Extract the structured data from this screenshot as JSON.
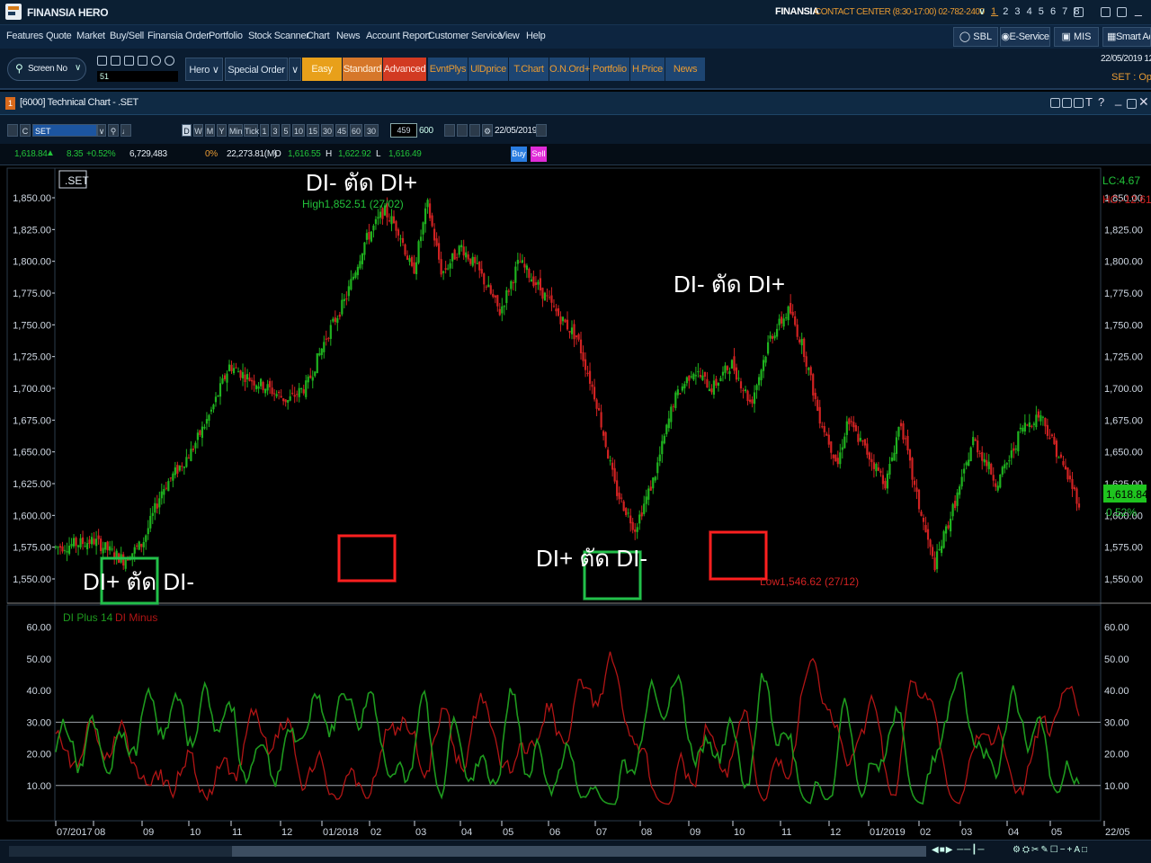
{
  "app": {
    "brand": "FINANSIA HERO",
    "brand_right": "FINANSIA",
    "contact": "CONTACT CENTER (8:30-17:00) 02-782-2400",
    "page_numbers": [
      "1",
      "2",
      "3",
      "4",
      "5",
      "6",
      "7",
      "8"
    ]
  },
  "menu": [
    "Features",
    "Quote",
    "Market",
    "Buy/Sell",
    "Finansia Order",
    "Portfolio",
    "Stock Scanner",
    "Chart",
    "News",
    "Account Report",
    "Customer Service",
    "View",
    "Help"
  ],
  "right_menu": {
    "sbl": "SBL",
    "eservice": "E-Service",
    "mis": "MIS",
    "smart": "Smart Ac"
  },
  "toolbar": {
    "screen_label": "Screen No",
    "screen_value": "51",
    "hero": "Hero",
    "special_order": "Special Order",
    "easy": "Easy",
    "standard": "Standard",
    "advanced": "Advanced",
    "tabs": [
      "EvntPlys",
      "UlDprice",
      "T.Chart",
      "O.N.Ord+",
      "Portfolio",
      "H.Price",
      "News"
    ],
    "date": "22/05/2019 12",
    "market_status": "SET : Ope"
  },
  "window": {
    "title": "[6000] Technical Chart - .SET",
    "badge": "1"
  },
  "chart_controls": {
    "periods": [
      "D",
      "W",
      "M",
      "Y",
      "Min",
      "Tick",
      "1",
      "3",
      "5",
      "10",
      "15",
      "30",
      "45",
      "60",
      "30"
    ],
    "symbol": "SET",
    "bars": "459",
    "bars_max": "600",
    "date": "22/05/2019"
  },
  "quote": {
    "last": "1,618.84",
    "change": "8.35",
    "change_pct": "+0.52%",
    "volume": "6,729,483",
    "pct": "0%",
    "value": "22,273.81(M)",
    "open_label": "O",
    "open": "1,616.55",
    "high_label": "H",
    "high": "1,622.92",
    "low_label": "L",
    "low": "1,616.49",
    "buy": "Buy",
    "sell": "Sell"
  },
  "colors": {
    "up": "#1fb31f",
    "down": "#d12222",
    "di_plus": "#1e9a1e",
    "di_minus": "#b21515",
    "box_green": "#22c04a",
    "box_red": "#ff2020",
    "accent": "#1f4a7a"
  },
  "chart_data": {
    "type": "candlestick",
    "symbol_label": ".SET",
    "x_ticks": [
      "07/2017",
      "08",
      "09",
      "10",
      "11",
      "12",
      "01/2018",
      "02",
      "03",
      "04",
      "05",
      "06",
      "07",
      "08",
      "09",
      "10",
      "11",
      "12",
      "01/2019",
      "02",
      "03",
      "04",
      "05",
      "22/05"
    ],
    "price_axis": {
      "min": 1540,
      "max": 1860,
      "ticks": [
        1550,
        1575,
        1600,
        1625,
        1650,
        1675,
        1700,
        1725,
        1750,
        1775,
        1800,
        1825,
        1850
      ]
    },
    "price_path": [
      [
        0,
        1575
      ],
      [
        0.04,
        1580
      ],
      [
        0.07,
        1565
      ],
      [
        0.09,
        1578
      ],
      [
        0.11,
        1620
      ],
      [
        0.14,
        1650
      ],
      [
        0.16,
        1680
      ],
      [
        0.18,
        1718
      ],
      [
        0.2,
        1708
      ],
      [
        0.22,
        1700
      ],
      [
        0.24,
        1690
      ],
      [
        0.26,
        1702
      ],
      [
        0.28,
        1740
      ],
      [
        0.3,
        1770
      ],
      [
        0.32,
        1815
      ],
      [
        0.34,
        1840
      ],
      [
        0.355,
        1825
      ],
      [
        0.37,
        1790
      ],
      [
        0.385,
        1845
      ],
      [
        0.4,
        1790
      ],
      [
        0.42,
        1812
      ],
      [
        0.44,
        1790
      ],
      [
        0.46,
        1760
      ],
      [
        0.48,
        1800
      ],
      [
        0.5,
        1780
      ],
      [
        0.52,
        1758
      ],
      [
        0.54,
        1740
      ],
      [
        0.56,
        1690
      ],
      [
        0.58,
        1620
      ],
      [
        0.6,
        1590
      ],
      [
        0.62,
        1630
      ],
      [
        0.64,
        1690
      ],
      [
        0.66,
        1715
      ],
      [
        0.68,
        1700
      ],
      [
        0.7,
        1720
      ],
      [
        0.72,
        1688
      ],
      [
        0.74,
        1740
      ],
      [
        0.76,
        1762
      ],
      [
        0.775,
        1730
      ],
      [
        0.79,
        1680
      ],
      [
        0.81,
        1640
      ],
      [
        0.82,
        1675
      ],
      [
        0.84,
        1650
      ],
      [
        0.86,
        1625
      ],
      [
        0.875,
        1675
      ],
      [
        0.89,
        1620
      ],
      [
        0.9,
        1590
      ],
      [
        0.91,
        1560
      ],
      [
        0.925,
        1595
      ],
      [
        0.94,
        1630
      ],
      [
        0.95,
        1660
      ],
      [
        0.965,
        1640
      ],
      [
        0.975,
        1625
      ],
      [
        0.99,
        1648
      ],
      [
        1,
        1668
      ],
      [
        1.02,
        1680
      ],
      [
        1.04,
        1645
      ],
      [
        1.06,
        1610
      ]
    ],
    "last_price": "1,618.84",
    "last_change": "0.52%",
    "high_annotation": "High1,852.51 (27/02)",
    "low_annotation": "Low1,546.62 (27/12)",
    "right_top": {
      "lc": "LC:4.67",
      "hc": "HC:-12.61"
    },
    "annotations": [
      "DI- ตัด DI+",
      "DI- ตัด DI+",
      "DI+ ตัด DI-",
      "DI+ ตัด DI-"
    ],
    "indicator": {
      "legend_plus": "DI Plus 14",
      "legend_minus": "DI Minus",
      "axis": {
        "min": 0,
        "max": 65,
        "ticks": [
          10,
          20,
          30,
          40,
          50,
          60
        ]
      },
      "reference_lines": [
        10,
        30
      ]
    }
  },
  "statusbar": {
    "text": ""
  }
}
